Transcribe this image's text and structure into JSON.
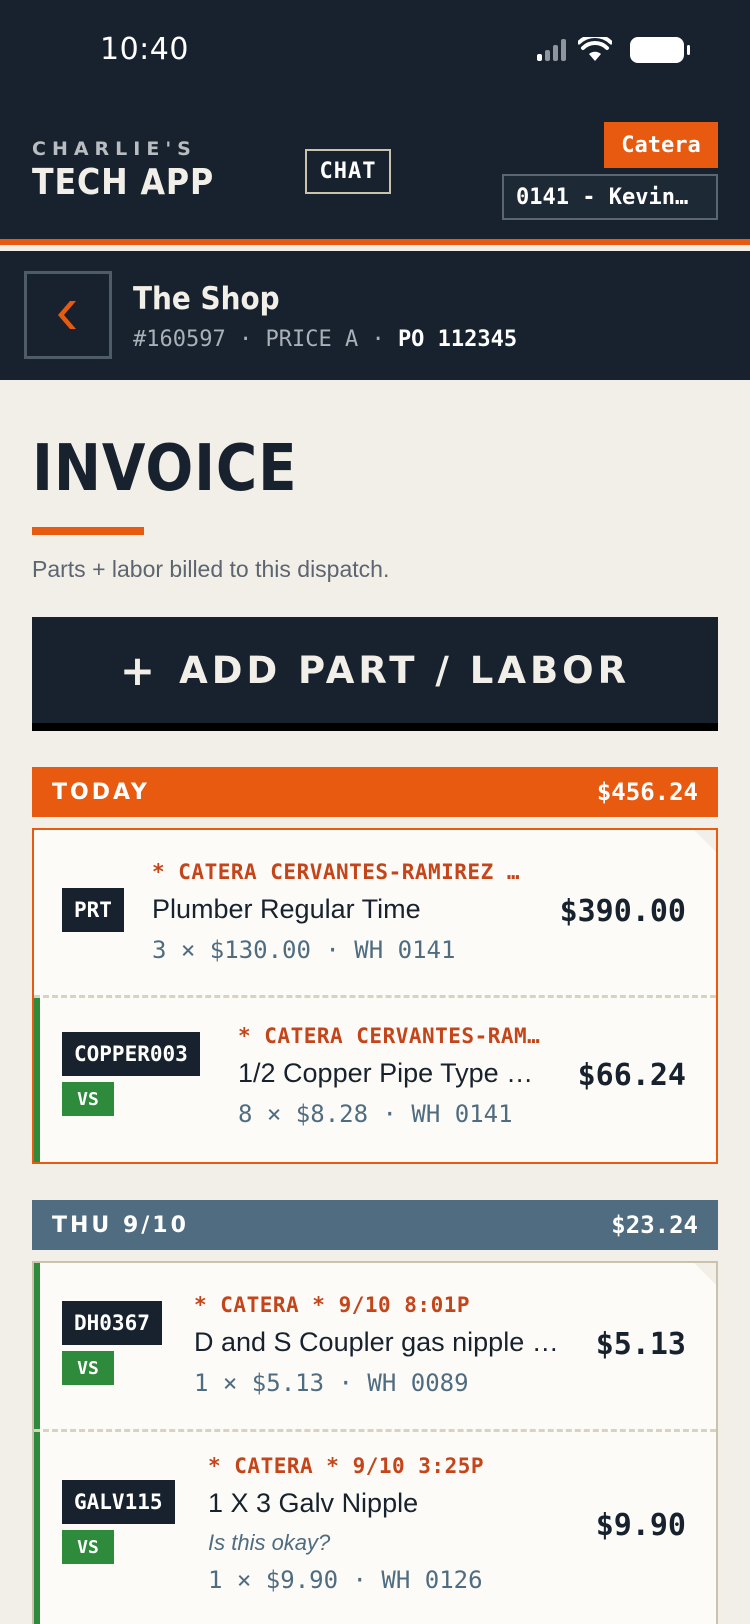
{
  "status_bar": {
    "time": "10:40"
  },
  "header": {
    "brand_top": "CHARLIE'S",
    "brand_main": "TECH APP",
    "chat_label": "CHAT",
    "tenant": "Catera",
    "technician": "0141 - Kevin…"
  },
  "job": {
    "title": "The Shop",
    "number": "#160597",
    "price_level": "PRICE A",
    "po": "PO 112345",
    "sep": "·"
  },
  "page": {
    "title": "INVOICE",
    "subtitle": "Parts + labor billed to this dispatch.",
    "add_button_plus": "+",
    "add_button_label": "ADD PART / LABOR"
  },
  "days": [
    {
      "label": "TODAY",
      "total": "$456.24",
      "items": [
        {
          "code": "PRT",
          "vs": "",
          "meta": "* CATERA CERVANTES-RAMIREZ …",
          "name": "Plumber Regular Time",
          "note": "",
          "qty": "3 × $130.00 · WH 0141",
          "price": "$390.00"
        },
        {
          "code": "COPPER003",
          "vs": "VS",
          "meta": "* CATERA CERVANTES-RAM…",
          "name": "1/2 Copper Pipe Type …",
          "note": "",
          "qty": "8 × $8.28 · WH 0141",
          "price": "$66.24"
        }
      ]
    },
    {
      "label": "THU 9/10",
      "total": "$23.24",
      "items": [
        {
          "code": "DH0367",
          "vs": "VS",
          "meta": "* CATERA * 9/10 8:01P",
          "name": "D and S Coupler gas nipple …",
          "note": "",
          "qty": "1 × $5.13 · WH 0089",
          "price": "$5.13"
        },
        {
          "code": "GALV115",
          "vs": "VS",
          "meta": "* CATERA * 9/10 3:25P",
          "name": "1 X 3 Galv Nipple",
          "note": "Is this okay?",
          "qty": "1 × $9.90 · WH 0126",
          "price": "$9.90"
        }
      ]
    }
  ],
  "colors": {
    "navy": "#17222e",
    "accent": "#e85a10",
    "slate": "#4f6c80",
    "green": "#2e8b3c",
    "paper": "#f2efe8"
  }
}
